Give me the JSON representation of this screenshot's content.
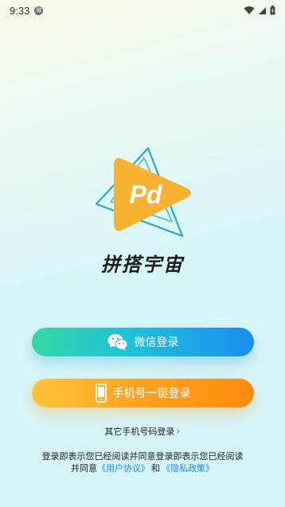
{
  "status_bar": {
    "time": "9:33",
    "notification_badge": "微"
  },
  "app": {
    "name": "拼搭宇宙",
    "logo_text": "Pd",
    "colors": {
      "logo_orange": "#f7b133",
      "logo_triangle_outline": "#29a8c9"
    }
  },
  "buttons": {
    "wechat_label": "微信登录",
    "wechat_icon": "wechat-icon",
    "phone_label": "手机号一键登录",
    "phone_icon": "phone-icon",
    "colors": {
      "wechat_start": "#35d7a4",
      "wechat_end": "#1a8cf3",
      "phone_start": "#ffc23a",
      "phone_end": "#ff8a0e"
    }
  },
  "other_login": {
    "label": "其它手机号码登录",
    "chevron": "›"
  },
  "agreement": {
    "line1": "登录即表示您已经阅读并同意登录即表示您已经阅读",
    "line2_prefix": "并同意",
    "user_agreement": "《用户协议》",
    "and": "和",
    "privacy_policy": "《隐私政策》"
  }
}
